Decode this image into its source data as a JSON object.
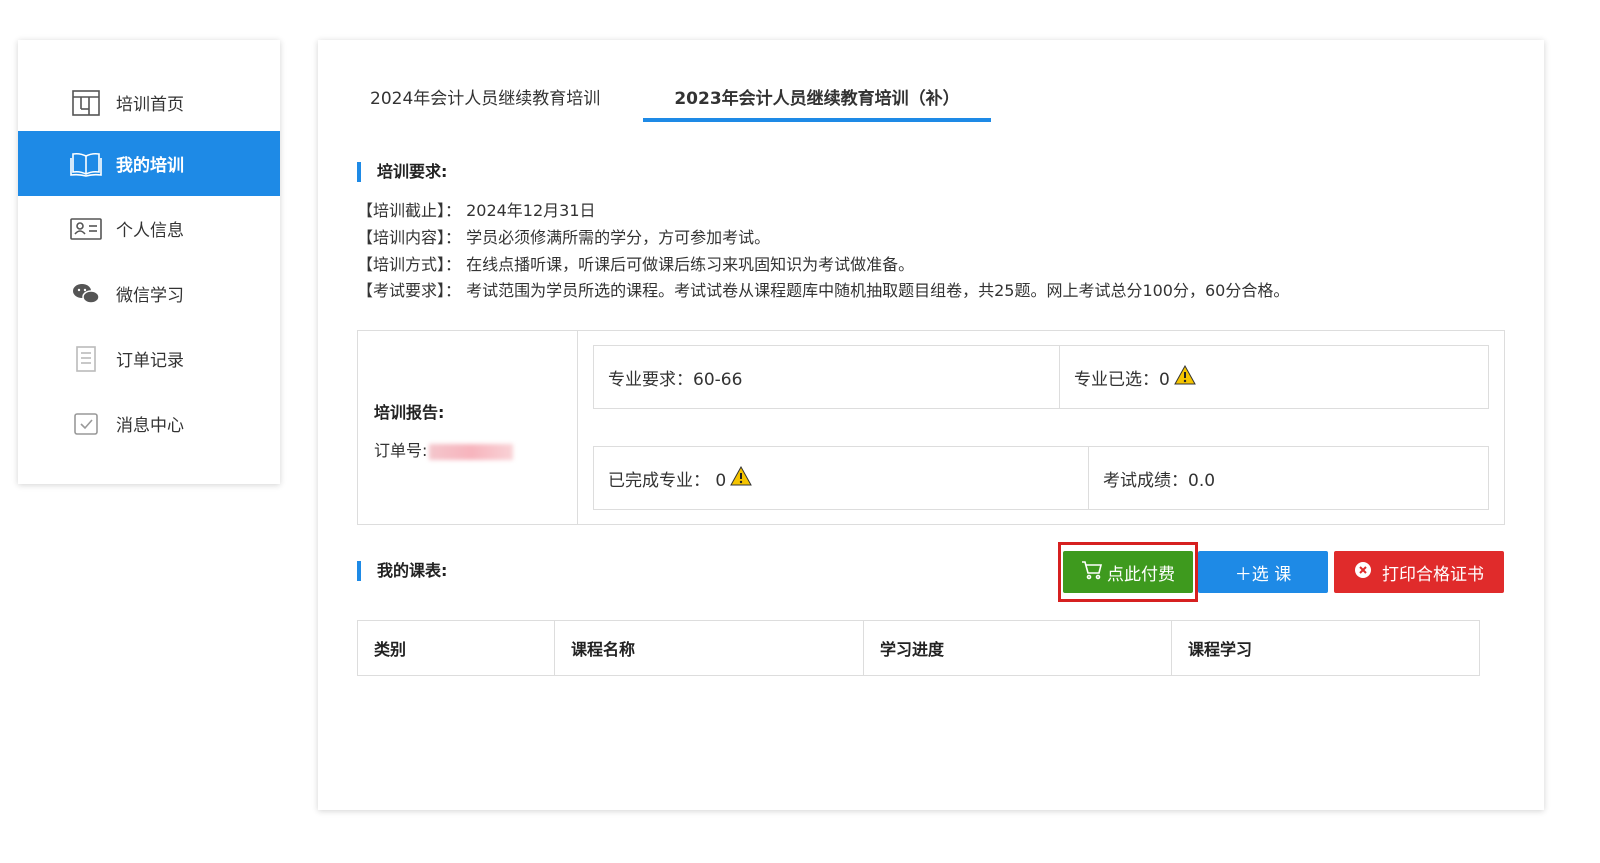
{
  "sidebar": {
    "items": [
      {
        "label": "培训首页",
        "icon": "store-icon"
      },
      {
        "label": "我的培训",
        "icon": "book-icon",
        "active": true
      },
      {
        "label": "个人信息",
        "icon": "id-card-icon"
      },
      {
        "label": "微信学习",
        "icon": "wechat-icon"
      },
      {
        "label": "订单记录",
        "icon": "document-icon"
      },
      {
        "label": "消息中心",
        "icon": "checkbox-icon"
      }
    ]
  },
  "tabs": [
    {
      "label": "2024年会计人员继续教育培训"
    },
    {
      "label": "2023年会计人员继续教育培训（补）",
      "active": true
    }
  ],
  "requirements": {
    "title": "培训要求:",
    "lines": [
      "【培训截止】： 2024年12月31日",
      "【培训内容】： 学员必须修满所需的学分，方可参加考试。",
      "【培训方式】： 在线点播听课，听课后可做课后练习来巩固知识为考试做准备。",
      "【考试要求】： 考试范围为学员所选的课程。考试试卷从课程题库中随机抽取题目组卷，共25题。网上考试总分100分，60分合格。"
    ]
  },
  "report": {
    "title": "培训报告:",
    "order_label": "订单号:",
    "major_required": "专业要求：60-66",
    "major_selected": "专业已选：0",
    "major_completed": "已完成专业：  0",
    "exam_score": "考试成绩：0.0"
  },
  "schedule": {
    "title": "我的课表:",
    "pay_button": "点此付费",
    "select_button": "＋选  课",
    "print_button": "打印合格证书",
    "columns": [
      "类别",
      "课程名称",
      "学习进度",
      "课程学习"
    ]
  },
  "colors": {
    "accent": "#1e8ae6",
    "pay": "#3e9a1e",
    "print": "#e02b2b",
    "highlight_border": "#d62020"
  }
}
